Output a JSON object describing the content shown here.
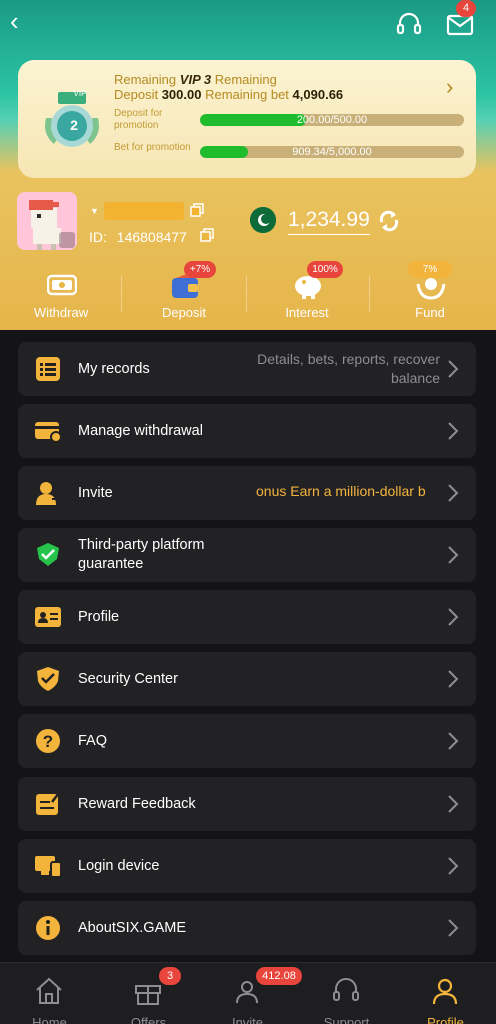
{
  "header": {
    "back_icon": "chevron-left-icon",
    "support_icon": "headset-icon",
    "mail_icon": "mail-icon",
    "mail_badge": "4"
  },
  "vip": {
    "remaining_prefix": "Remaining",
    "level": "VIP 3",
    "remaining_suffix": "Remaining",
    "deposit_label": "Deposit",
    "deposit_value": "300.00",
    "bet_label": "Remaining bet",
    "bet_value": "4,090.66",
    "current_level": "2",
    "badge_text": "VIP",
    "deposit_promo_label": "Deposit for promotion",
    "deposit_progress_text": "200.00/500.00",
    "deposit_progress": 0.4,
    "bet_promo_label": "Bet for promotion",
    "bet_progress_text": "909.34/5,000.00",
    "bet_progress": 0.18
  },
  "user": {
    "id_label": "ID:",
    "id_value": "146808477",
    "balance": "1,234.99"
  },
  "quick_actions": [
    {
      "label": "Withdraw",
      "icon": "withdraw-icon",
      "badge": ""
    },
    {
      "label": "Deposit",
      "icon": "wallet-icon",
      "badge": "+7%"
    },
    {
      "label": "Interest",
      "icon": "piggy-bank-icon",
      "badge": "100%"
    },
    {
      "label": "Fund",
      "icon": "hands-coin-icon",
      "badge": "7%"
    }
  ],
  "menu": [
    {
      "label": "My records",
      "icon": "list-icon",
      "sub": "Details, bets, reports, recover balance"
    },
    {
      "label": "Manage withdrawal",
      "icon": "card-gear-icon",
      "sub": ""
    },
    {
      "label": "Invite",
      "icon": "user-plus-icon",
      "promo": "onus  Earn a million-dollar b"
    },
    {
      "label": "Third-party platform guarantee",
      "icon": "verified-shield-icon",
      "sub": ""
    },
    {
      "label": "Profile",
      "icon": "id-card-icon",
      "sub": ""
    },
    {
      "label": "Security Center",
      "icon": "shield-check-icon",
      "sub": ""
    },
    {
      "label": "FAQ",
      "icon": "question-icon",
      "sub": ""
    },
    {
      "label": "Reward Feedback",
      "icon": "edit-note-icon",
      "sub": ""
    },
    {
      "label": "Login device",
      "icon": "devices-icon",
      "sub": ""
    },
    {
      "label": "AboutSIX.GAME",
      "icon": "info-icon",
      "sub": ""
    }
  ],
  "tabs": [
    {
      "label": "Home",
      "icon": "home-icon",
      "badge": "",
      "active": false
    },
    {
      "label": "Offers",
      "icon": "gift-icon",
      "badge": "3",
      "active": false
    },
    {
      "label": "Invite",
      "icon": "users-icon",
      "badge": "412.08",
      "active": false
    },
    {
      "label": "Support",
      "icon": "headset-icon",
      "badge": "",
      "active": false
    },
    {
      "label": "Profile",
      "icon": "person-icon",
      "badge": "",
      "active": true
    }
  ],
  "colors": {
    "accent": "#f3b43b",
    "progress": "#1fbd2d",
    "badge": "#e8453c",
    "card_bg": "#222225"
  }
}
